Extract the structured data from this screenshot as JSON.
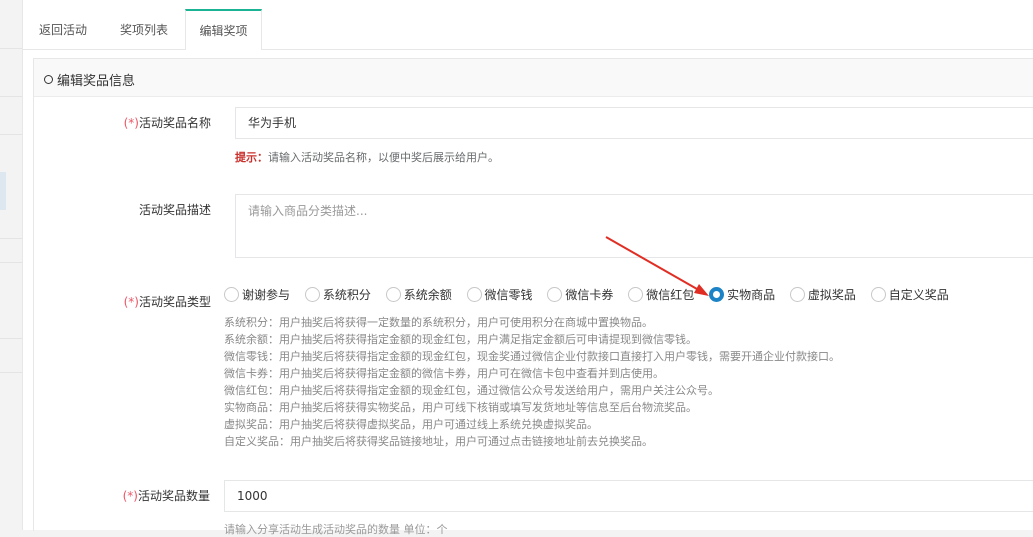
{
  "tabs": [
    {
      "label": "返回活动"
    },
    {
      "label": "奖项列表"
    },
    {
      "label": "编辑奖项"
    }
  ],
  "section": {
    "title": "编辑奖品信息"
  },
  "form": {
    "required_mark": "(*)",
    "name": {
      "label": "活动奖品名称",
      "value": "华为手机",
      "hint_key": "提示：",
      "hint": "请输入活动奖品名称，以便中奖后展示给用户。"
    },
    "description": {
      "label": "活动奖品描述",
      "placeholder": "请输入商品分类描述..."
    },
    "type": {
      "label": "活动奖品类型",
      "options": [
        {
          "label": "谢谢参与",
          "checked": false
        },
        {
          "label": "系统积分",
          "checked": false
        },
        {
          "label": "系统余额",
          "checked": false
        },
        {
          "label": "微信零钱",
          "checked": false
        },
        {
          "label": "微信卡券",
          "checked": false
        },
        {
          "label": "微信红包",
          "checked": false
        },
        {
          "label": "实物商品",
          "checked": true
        },
        {
          "label": "虚拟奖品",
          "checked": false
        },
        {
          "label": "自定义奖品",
          "checked": false
        }
      ],
      "descriptions": [
        "系统积分：用户抽奖后将获得一定数量的系统积分，用户可使用积分在商城中置换物品。",
        "系统余额：用户抽奖后将获得指定金额的现金红包，用户满足指定金额后可申请提现到微信零钱。",
        "微信零钱：用户抽奖后将获得指定金额的现金红包，现金奖通过微信企业付款接口直接打入用户零钱，需要开通企业付款接口。",
        "微信卡券：用户抽奖后将获得指定金额的微信卡券，用户可在微信卡包中查看并到店使用。",
        "微信红包：用户抽奖后将获得指定金额的现金红包，通过微信公众号发送给用户，需用户关注公众号。",
        "实物商品：用户抽奖后将获得实物奖品，用户可线下核销或填写发货地址等信息至后台物流奖品。",
        "虚拟奖品：用户抽奖后将获得虚拟奖品，用户可通过线上系统兑换虚拟奖品。",
        "自定义奖品：用户抽奖后将获得奖品链接地址，用户可通过点击链接地址前去兑换奖品。"
      ]
    },
    "quantity": {
      "label": "活动奖品数量",
      "value": "1000",
      "hint": "请输入分享活动生成活动奖品的数量 单位：个"
    }
  },
  "colors": {
    "accent": "#1c84c6",
    "tab_active": "#1ab394",
    "required": "#ed5565",
    "annotation_arrow": "#e02e24"
  }
}
